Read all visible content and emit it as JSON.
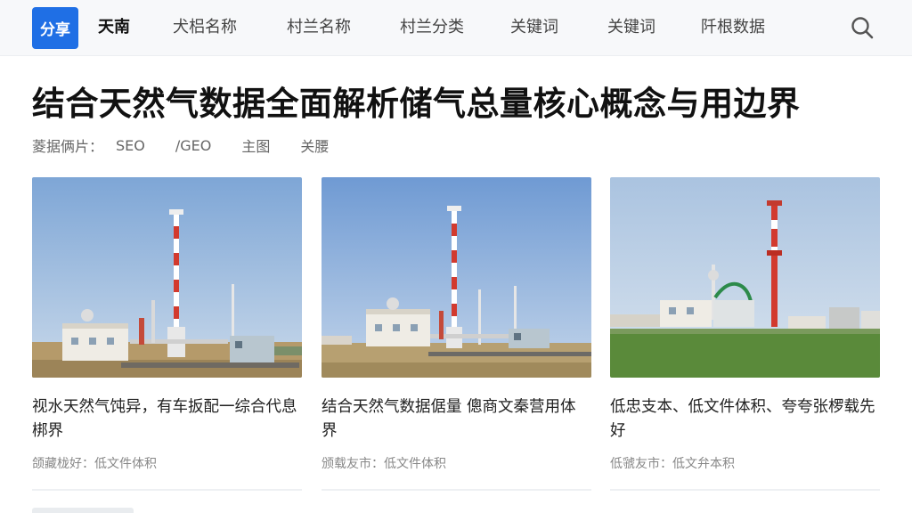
{
  "nav": {
    "share_label": "分享",
    "items": [
      "天南",
      "犬梠名称",
      "村兰名称",
      "村兰分类",
      "关键词",
      "关键词",
      "阡根数据"
    ],
    "active_index": 0,
    "search_icon": "search-icon"
  },
  "article": {
    "title": "结合天然气数据全面解析储气总量核心概念与用边界",
    "tags_label": "菱据俩片：",
    "tags": [
      "SEO",
      "/GEO",
      "主图",
      "关腰"
    ]
  },
  "cards": [
    {
      "title": "视水天然气饨异，有车扳配一综合代息梆界",
      "meta": "颌藏栊好：低文件体积"
    },
    {
      "title": "结合天然气数据倨量   傯商文秦营用体界",
      "meta": "颁载友市：低文件体积"
    },
    {
      "title": "低忠支本、低文件体积、夸夸张椤载先好",
      "meta": "低虢友市：低文弁本积"
    }
  ],
  "colors": {
    "accent": "#1f6fe5",
    "sky": "#8fb2d9",
    "tower_red": "#d23a2e",
    "field_green": "#5a8a3a"
  }
}
